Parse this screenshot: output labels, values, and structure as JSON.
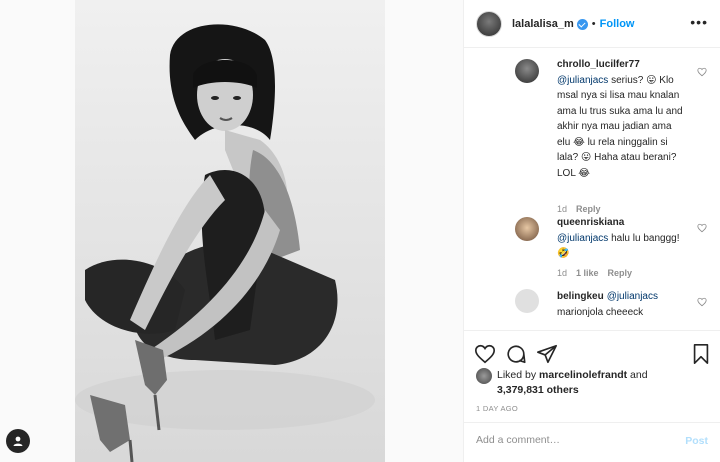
{
  "header": {
    "username": "lalalalisa_m",
    "separator": "•",
    "follow_label": "Follow",
    "more_label": "•••"
  },
  "comments": [
    {
      "username": "chrollo_lucilfer77",
      "mention": "@julianjacs",
      "text": " serius? 😛 Klo msal nya si lisa mau knalan ama lu trus suka ama lu and akhir nya mau jadian ama elu 😂 lu rela ninggalin si lala? 😛 Haha atau berani? LOL 😂",
      "age": "1d",
      "likes": "",
      "reply_label": "Reply"
    },
    {
      "username": "queenriskiana",
      "mention": "@julianjacs",
      "text": " halu lu banggg!🤣",
      "age": "1d",
      "likes": "1 like",
      "reply_label": "Reply"
    },
    {
      "username": "belingkeu",
      "mention": "@julianjacs",
      "text": " marionjola cheeeck",
      "age": "",
      "likes": "",
      "reply_label": ""
    }
  ],
  "likes": {
    "prefix": "Liked by ",
    "user": "marcelinolefrandt",
    "and": " and ",
    "count": "3,379,831 others"
  },
  "timestamp": "1 DAY AGO",
  "add_comment": {
    "placeholder": "Add a comment…",
    "post_label": "Post"
  },
  "icons": [
    "user-tag-icon",
    "more-icon",
    "heart-icon",
    "comment-icon",
    "share-icon",
    "save-icon",
    "verified-badge-icon"
  ],
  "colors": {
    "accent": "#0095f6",
    "post_disabled": "#b2dffc",
    "muted": "#8e8e8e",
    "verified": "#3897f0"
  }
}
